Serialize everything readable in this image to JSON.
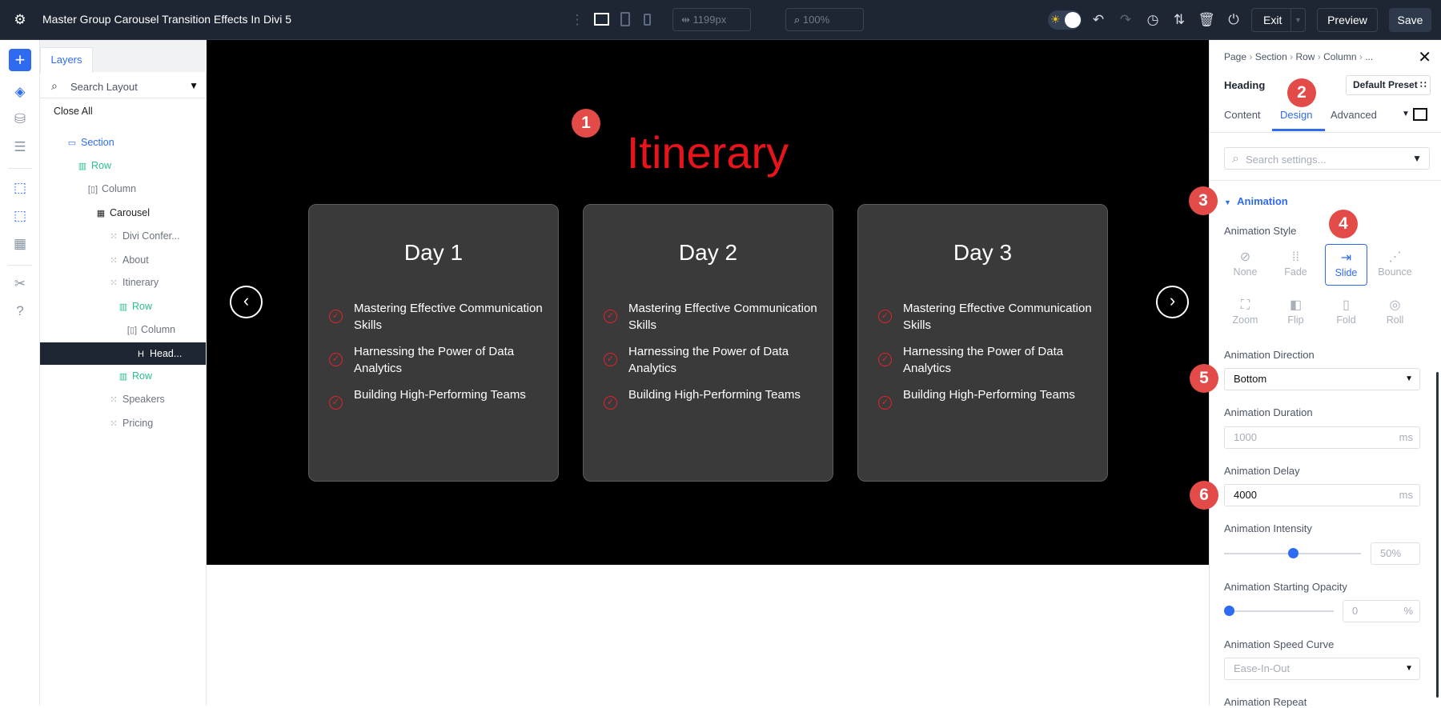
{
  "topbar": {
    "title": "Master Group Carousel Transition Effects In Divi 5",
    "width_value": "1199px",
    "zoom_value": "100%",
    "exit": "Exit",
    "preview": "Preview",
    "save": "Save"
  },
  "layers": {
    "tab": "Layers",
    "search_placeholder": "Search Layout",
    "close_all": "Close All",
    "items": [
      {
        "label": "Section",
        "type": "section"
      },
      {
        "label": "Row",
        "type": "row"
      },
      {
        "label": "Column",
        "type": "column"
      },
      {
        "label": "Carousel",
        "type": "carousel"
      },
      {
        "label": "Divi Confer...",
        "type": "group"
      },
      {
        "label": "About",
        "type": "group"
      },
      {
        "label": "Itinerary",
        "type": "group"
      },
      {
        "label": "Row",
        "type": "row"
      },
      {
        "label": "Column",
        "type": "column"
      },
      {
        "label": "Head...",
        "type": "heading"
      },
      {
        "label": "Row",
        "type": "row"
      },
      {
        "label": "Speakers",
        "type": "group"
      },
      {
        "label": "Pricing",
        "type": "group"
      }
    ]
  },
  "canvas": {
    "heading": "Itinerary",
    "heading_color": "#e8141c",
    "cards": [
      {
        "title": "Day 1",
        "items": [
          "Mastering Effective Communication Skills",
          "Harnessing the Power of Data Analytics",
          "Building High-Performing Teams"
        ]
      },
      {
        "title": "Day 2",
        "items": [
          "Mastering Effective Communication Skills",
          "Harnessing the Power of Data Analytics",
          "Building High-Performing Teams"
        ]
      },
      {
        "title": "Day 3",
        "items": [
          "Mastering Effective Communication Skills",
          "Harnessing the Power of Data Analytics",
          "Building High-Performing Teams"
        ]
      }
    ]
  },
  "badges": [
    "1",
    "2",
    "3",
    "4",
    "5",
    "6"
  ],
  "panel": {
    "breadcrumb": [
      "Page",
      "Section",
      "Row",
      "Column",
      "..."
    ],
    "module": "Heading",
    "preset": "Default Preset",
    "tabs": [
      "Content",
      "Design",
      "Advanced"
    ],
    "active_tab": "Design",
    "search_placeholder": "Search settings...",
    "section": "Animation",
    "style_label": "Animation Style",
    "styles": [
      {
        "label": "None",
        "icon": "⊘"
      },
      {
        "label": "Fade",
        "icon": "⁞⁞"
      },
      {
        "label": "Slide",
        "icon": "⇥"
      },
      {
        "label": "Bounce",
        "icon": "⋰"
      },
      {
        "label": "Zoom",
        "icon": "⛶"
      },
      {
        "label": "Flip",
        "icon": "◧"
      },
      {
        "label": "Fold",
        "icon": "▯"
      },
      {
        "label": "Roll",
        "icon": "◎"
      }
    ],
    "selected_style": "Slide",
    "direction_label": "Animation Direction",
    "direction": "Bottom",
    "duration_label": "Animation Duration",
    "duration": "1000",
    "delay_label": "Animation Delay",
    "delay": "4000",
    "ms": "ms",
    "intensity_label": "Animation Intensity",
    "intensity": "50%",
    "intensity_value": 50,
    "opacity_label": "Animation Starting Opacity",
    "opacity": "0",
    "opacity_unit": "%",
    "opacity_value": 0,
    "curve_label": "Animation Speed Curve",
    "curve": "Ease-In-Out",
    "repeat_label": "Animation Repeat"
  }
}
